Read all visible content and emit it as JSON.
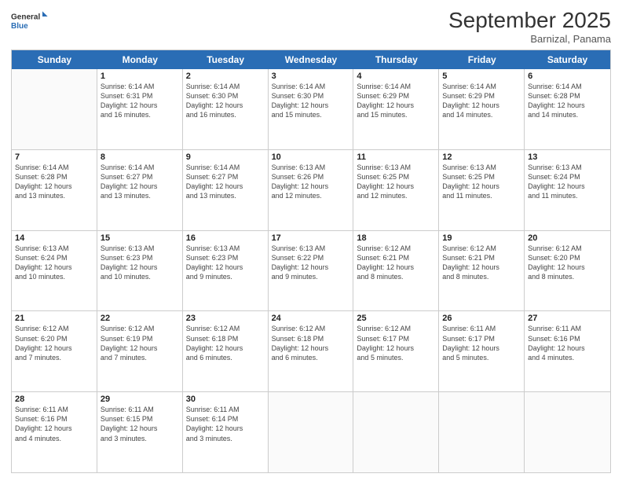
{
  "logo": {
    "line1": "General",
    "line2": "Blue"
  },
  "title": "September 2025",
  "location": "Barnizal, Panama",
  "headers": [
    "Sunday",
    "Monday",
    "Tuesday",
    "Wednesday",
    "Thursday",
    "Friday",
    "Saturday"
  ],
  "rows": [
    [
      {
        "date": "",
        "info": ""
      },
      {
        "date": "1",
        "info": "Sunrise: 6:14 AM\nSunset: 6:31 PM\nDaylight: 12 hours\nand 16 minutes."
      },
      {
        "date": "2",
        "info": "Sunrise: 6:14 AM\nSunset: 6:30 PM\nDaylight: 12 hours\nand 16 minutes."
      },
      {
        "date": "3",
        "info": "Sunrise: 6:14 AM\nSunset: 6:30 PM\nDaylight: 12 hours\nand 15 minutes."
      },
      {
        "date": "4",
        "info": "Sunrise: 6:14 AM\nSunset: 6:29 PM\nDaylight: 12 hours\nand 15 minutes."
      },
      {
        "date": "5",
        "info": "Sunrise: 6:14 AM\nSunset: 6:29 PM\nDaylight: 12 hours\nand 14 minutes."
      },
      {
        "date": "6",
        "info": "Sunrise: 6:14 AM\nSunset: 6:28 PM\nDaylight: 12 hours\nand 14 minutes."
      }
    ],
    [
      {
        "date": "7",
        "info": "Sunrise: 6:14 AM\nSunset: 6:28 PM\nDaylight: 12 hours\nand 13 minutes."
      },
      {
        "date": "8",
        "info": "Sunrise: 6:14 AM\nSunset: 6:27 PM\nDaylight: 12 hours\nand 13 minutes."
      },
      {
        "date": "9",
        "info": "Sunrise: 6:14 AM\nSunset: 6:27 PM\nDaylight: 12 hours\nand 13 minutes."
      },
      {
        "date": "10",
        "info": "Sunrise: 6:13 AM\nSunset: 6:26 PM\nDaylight: 12 hours\nand 12 minutes."
      },
      {
        "date": "11",
        "info": "Sunrise: 6:13 AM\nSunset: 6:25 PM\nDaylight: 12 hours\nand 12 minutes."
      },
      {
        "date": "12",
        "info": "Sunrise: 6:13 AM\nSunset: 6:25 PM\nDaylight: 12 hours\nand 11 minutes."
      },
      {
        "date": "13",
        "info": "Sunrise: 6:13 AM\nSunset: 6:24 PM\nDaylight: 12 hours\nand 11 minutes."
      }
    ],
    [
      {
        "date": "14",
        "info": "Sunrise: 6:13 AM\nSunset: 6:24 PM\nDaylight: 12 hours\nand 10 minutes."
      },
      {
        "date": "15",
        "info": "Sunrise: 6:13 AM\nSunset: 6:23 PM\nDaylight: 12 hours\nand 10 minutes."
      },
      {
        "date": "16",
        "info": "Sunrise: 6:13 AM\nSunset: 6:23 PM\nDaylight: 12 hours\nand 9 minutes."
      },
      {
        "date": "17",
        "info": "Sunrise: 6:13 AM\nSunset: 6:22 PM\nDaylight: 12 hours\nand 9 minutes."
      },
      {
        "date": "18",
        "info": "Sunrise: 6:12 AM\nSunset: 6:21 PM\nDaylight: 12 hours\nand 8 minutes."
      },
      {
        "date": "19",
        "info": "Sunrise: 6:12 AM\nSunset: 6:21 PM\nDaylight: 12 hours\nand 8 minutes."
      },
      {
        "date": "20",
        "info": "Sunrise: 6:12 AM\nSunset: 6:20 PM\nDaylight: 12 hours\nand 8 minutes."
      }
    ],
    [
      {
        "date": "21",
        "info": "Sunrise: 6:12 AM\nSunset: 6:20 PM\nDaylight: 12 hours\nand 7 minutes."
      },
      {
        "date": "22",
        "info": "Sunrise: 6:12 AM\nSunset: 6:19 PM\nDaylight: 12 hours\nand 7 minutes."
      },
      {
        "date": "23",
        "info": "Sunrise: 6:12 AM\nSunset: 6:18 PM\nDaylight: 12 hours\nand 6 minutes."
      },
      {
        "date": "24",
        "info": "Sunrise: 6:12 AM\nSunset: 6:18 PM\nDaylight: 12 hours\nand 6 minutes."
      },
      {
        "date": "25",
        "info": "Sunrise: 6:12 AM\nSunset: 6:17 PM\nDaylight: 12 hours\nand 5 minutes."
      },
      {
        "date": "26",
        "info": "Sunrise: 6:11 AM\nSunset: 6:17 PM\nDaylight: 12 hours\nand 5 minutes."
      },
      {
        "date": "27",
        "info": "Sunrise: 6:11 AM\nSunset: 6:16 PM\nDaylight: 12 hours\nand 4 minutes."
      }
    ],
    [
      {
        "date": "28",
        "info": "Sunrise: 6:11 AM\nSunset: 6:16 PM\nDaylight: 12 hours\nand 4 minutes."
      },
      {
        "date": "29",
        "info": "Sunrise: 6:11 AM\nSunset: 6:15 PM\nDaylight: 12 hours\nand 3 minutes."
      },
      {
        "date": "30",
        "info": "Sunrise: 6:11 AM\nSunset: 6:14 PM\nDaylight: 12 hours\nand 3 minutes."
      },
      {
        "date": "",
        "info": ""
      },
      {
        "date": "",
        "info": ""
      },
      {
        "date": "",
        "info": ""
      },
      {
        "date": "",
        "info": ""
      }
    ]
  ]
}
